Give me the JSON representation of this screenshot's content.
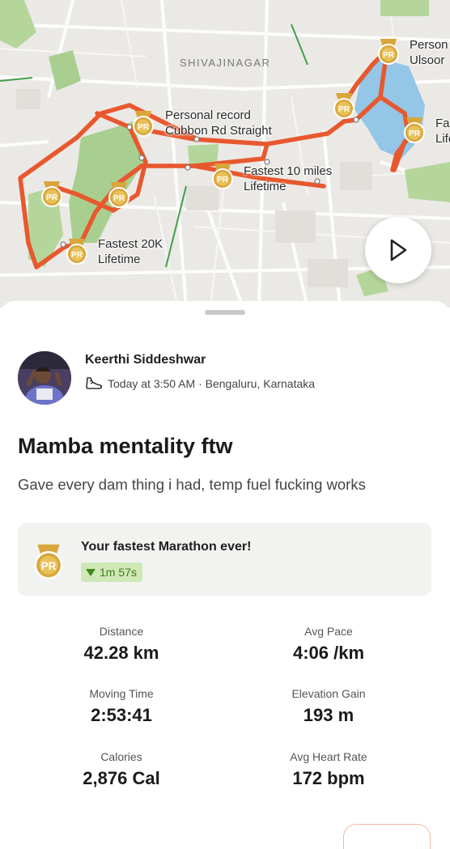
{
  "map": {
    "area_label": "SHIVAJINAGAR",
    "route_color": "#e8582e",
    "labels": {
      "pr1_line1": "Personal record",
      "pr1_line2": "Cubbon Rd Straight",
      "pr2_line1": "Fastest 10 miles",
      "pr2_line2": "Lifetime",
      "pr3_line1": "Fastest 20K",
      "pr3_line2": "Lifetime",
      "pr4_line1": "Person",
      "pr4_line2": "Ulsoor",
      "pr5_line1": "Fa",
      "pr5_line2": "Life"
    },
    "play_icon": "play-icon"
  },
  "activity": {
    "athlete": "Keerthi Siddeshwar",
    "meta": "Today at 3:50 AM · Bengaluru, Karnataka",
    "sport_icon": "running-shoe-icon",
    "title": "Mamba mentality ftw",
    "description": "Gave every dam thing i had, temp fuel fucking works"
  },
  "achievement": {
    "text": "Your fastest Marathon ever!",
    "delta": "1m 57s",
    "badge": "PR"
  },
  "stats": [
    {
      "label": "Distance",
      "value": "42.28 km"
    },
    {
      "label": "Avg Pace",
      "value": "4:06 /km"
    },
    {
      "label": "Moving Time",
      "value": "2:53:41"
    },
    {
      "label": "Elevation Gain",
      "value": "193 m"
    },
    {
      "label": "Calories",
      "value": "2,876 Cal"
    },
    {
      "label": "Avg Heart Rate",
      "value": "172 bpm"
    }
  ]
}
